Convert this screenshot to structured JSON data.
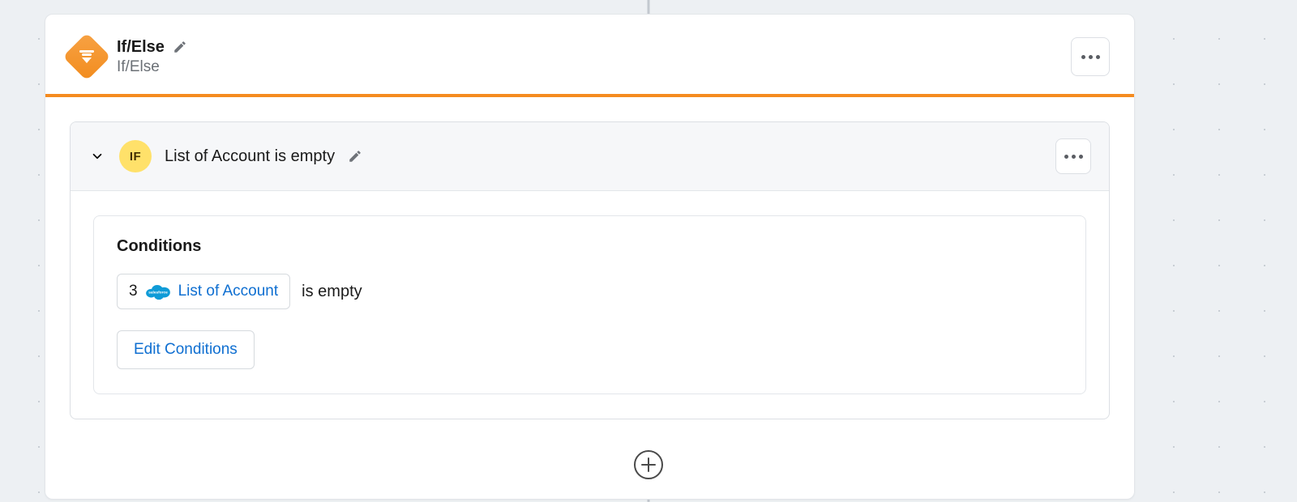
{
  "node": {
    "title": "If/Else",
    "subtitle": "If/Else"
  },
  "branch": {
    "badge": "IF",
    "title": "List of Account is empty"
  },
  "conditions": {
    "heading": "Conditions",
    "items": [
      {
        "step": "3",
        "variable": "List of Account",
        "operator": "is empty"
      }
    ],
    "edit_label": "Edit Conditions"
  }
}
